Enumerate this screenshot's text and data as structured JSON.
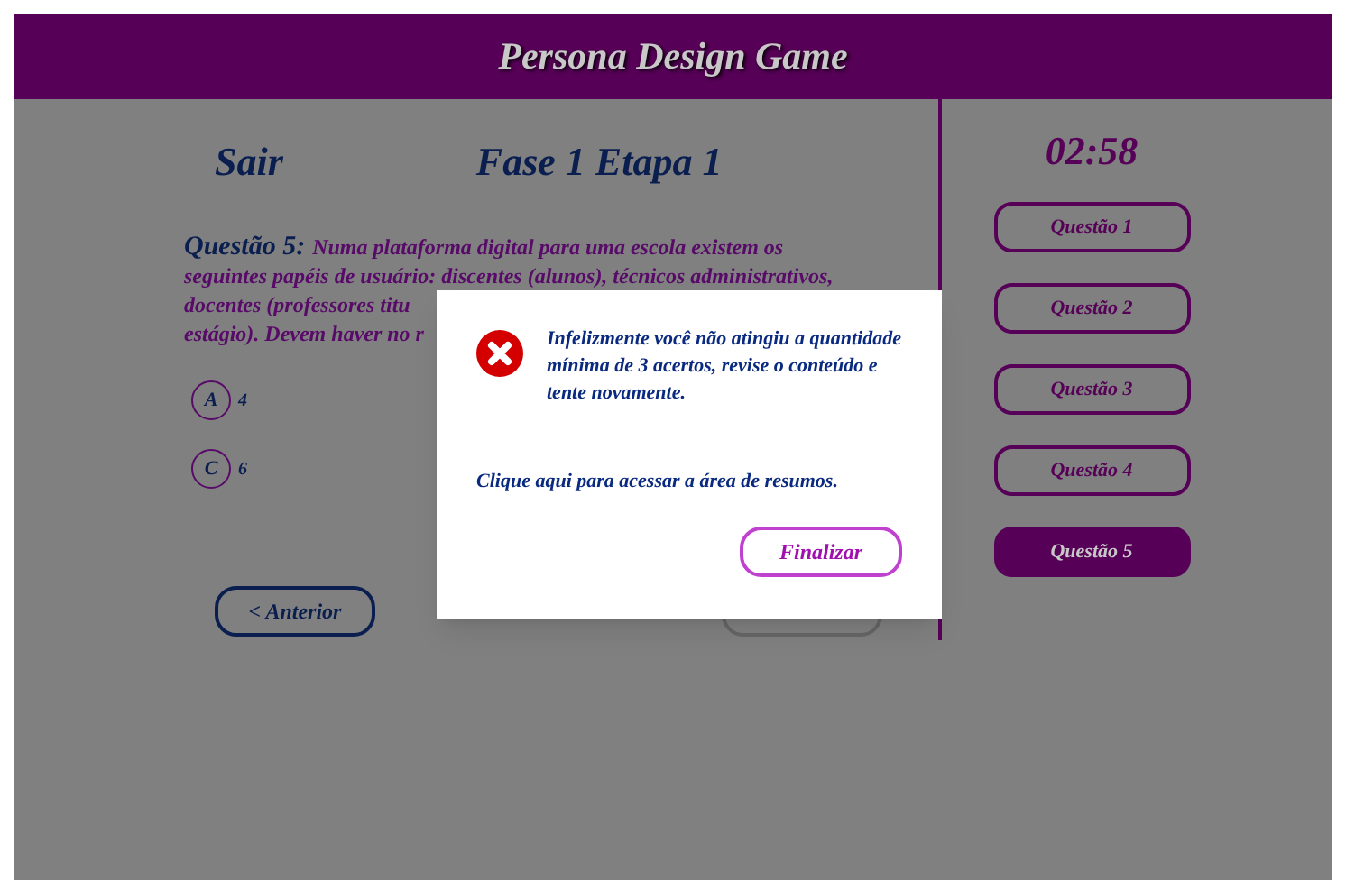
{
  "header": {
    "title": "Persona Design Game"
  },
  "nav": {
    "exit": "Sair",
    "stage": "Fase 1 Etapa 1"
  },
  "question": {
    "label": "Questão 5:",
    "lines": [
      "Numa plataforma digital para uma escola existem os",
      "seguintes papéis de usuário: discentes (alunos), técnicos administrativos,",
      "docentes (professores titu",
      "estágio). Devem haver no r"
    ]
  },
  "options": [
    {
      "letter": "A",
      "text": "4"
    },
    {
      "letter": "C",
      "text": "6"
    }
  ],
  "previous_button": "< Anterior",
  "timer": "02:58",
  "question_list": [
    {
      "label": "Questão 1",
      "selected": false
    },
    {
      "label": "Questão 2",
      "selected": false
    },
    {
      "label": "Questão 3",
      "selected": false
    },
    {
      "label": "Questão 4",
      "selected": false
    },
    {
      "label": "Questão 5",
      "selected": true
    }
  ],
  "dialog": {
    "message": "Infelizmente você não atingiu a quantidade mínima de 3 acertos, revise o conteúdo e tente novamente.",
    "link": "Clique aqui para acessar a área de resumos.",
    "button": "Finalizar"
  }
}
